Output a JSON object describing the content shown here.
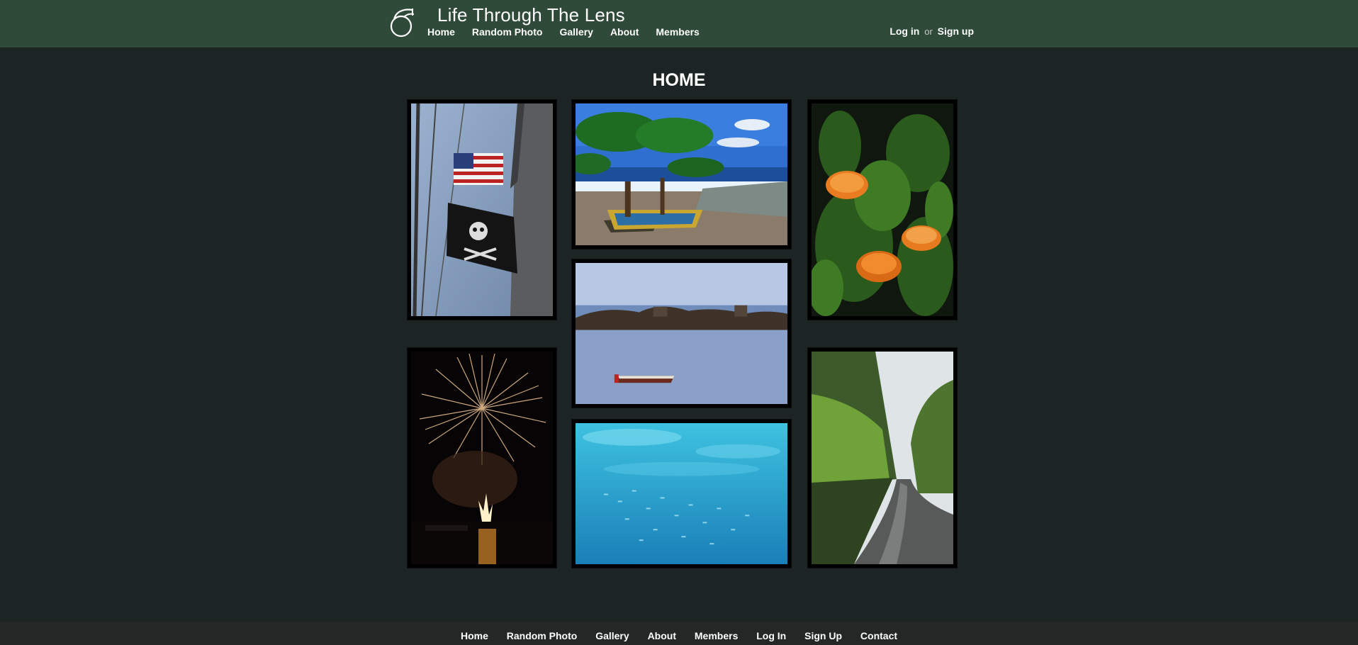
{
  "header": {
    "site_title": "Life Through The Lens",
    "logo_icon": "camera-lens-logo-icon",
    "nav": [
      {
        "label": "Home"
      },
      {
        "label": "Random Photo"
      },
      {
        "label": "Gallery"
      },
      {
        "label": "About"
      },
      {
        "label": "Members"
      }
    ],
    "auth": {
      "login": "Log in",
      "or": "or",
      "signup": "Sign up"
    }
  },
  "main": {
    "title": "HOME",
    "photos": [
      {
        "subject": "flags-on-ship-mast"
      },
      {
        "subject": "beach-boats-tree"
      },
      {
        "subject": "orange-mushrooms-moss"
      },
      {
        "subject": "boat-on-sea-rocks"
      },
      {
        "subject": "fireworks-harbor-night"
      },
      {
        "subject": "underwater-fish-school"
      },
      {
        "subject": "forest-road-rain"
      }
    ]
  },
  "footer": {
    "nav": [
      {
        "label": "Home"
      },
      {
        "label": "Random Photo"
      },
      {
        "label": "Gallery"
      },
      {
        "label": "About"
      },
      {
        "label": "Members"
      },
      {
        "label": "Log In"
      },
      {
        "label": "Sign Up"
      },
      {
        "label": "Contact"
      }
    ]
  },
  "colors": {
    "header_bg": "#2f4a39",
    "page_bg": "#1c2424",
    "footer_bg": "#232826",
    "text": "#ffffff"
  }
}
